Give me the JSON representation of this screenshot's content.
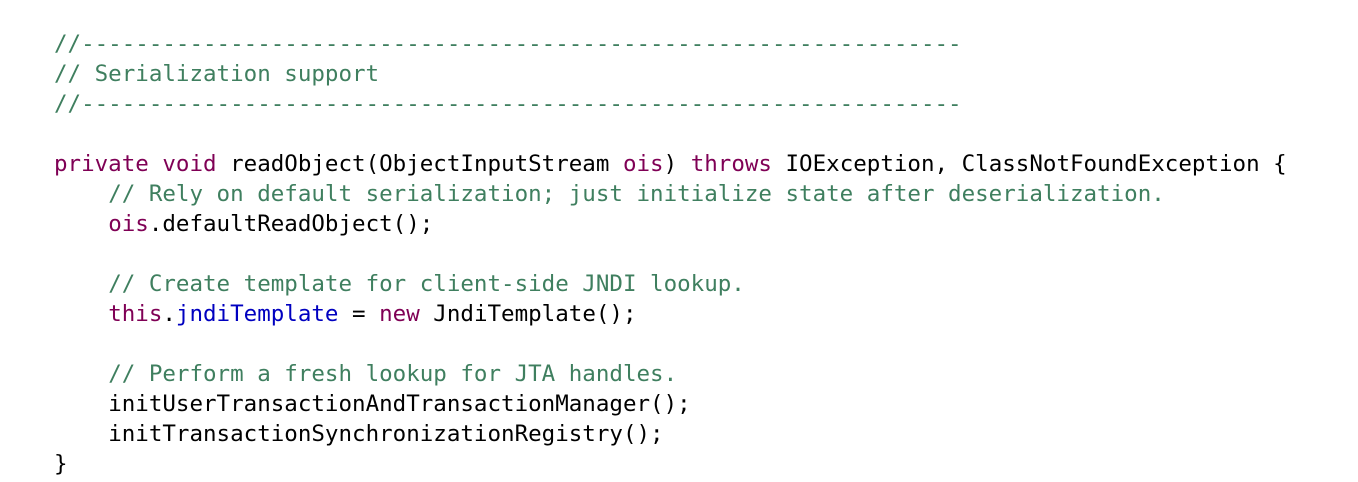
{
  "code": {
    "line_1": "//-----------------------------------------------------------------",
    "line_2": "// Serialization support",
    "line_3": "//-----------------------------------------------------------------",
    "line_5": {
      "kw_private": "private",
      "kw_void": "void",
      "method": "readObject(ObjectInputStream ",
      "param": "ois",
      "mid": ") ",
      "kw_throws": "throws",
      "rest": " IOException, ClassNotFoundException {"
    },
    "line_6": "// Rely on default serialization; just initialize state after deserialization.",
    "line_7": {
      "var": "ois",
      "rest": ".defaultReadObject();"
    },
    "line_9": "// Create template for client-side JNDI lookup.",
    "line_10": {
      "kw_this": "this",
      "dot": ".",
      "field": "jndiTemplate",
      "eq": " = ",
      "kw_new": "new",
      "rest": " JndiTemplate();"
    },
    "line_12": "// Perform a fresh lookup for JTA handles.",
    "line_13": "initUserTransactionAndTransactionManager();",
    "line_14": "initTransactionSynchronizationRegistry();",
    "line_15": "}"
  },
  "colors": {
    "comment": "#3f7f5f",
    "keyword": "#7f0055",
    "field": "#0000c0",
    "text": "#000000",
    "background": "#ffffff"
  }
}
